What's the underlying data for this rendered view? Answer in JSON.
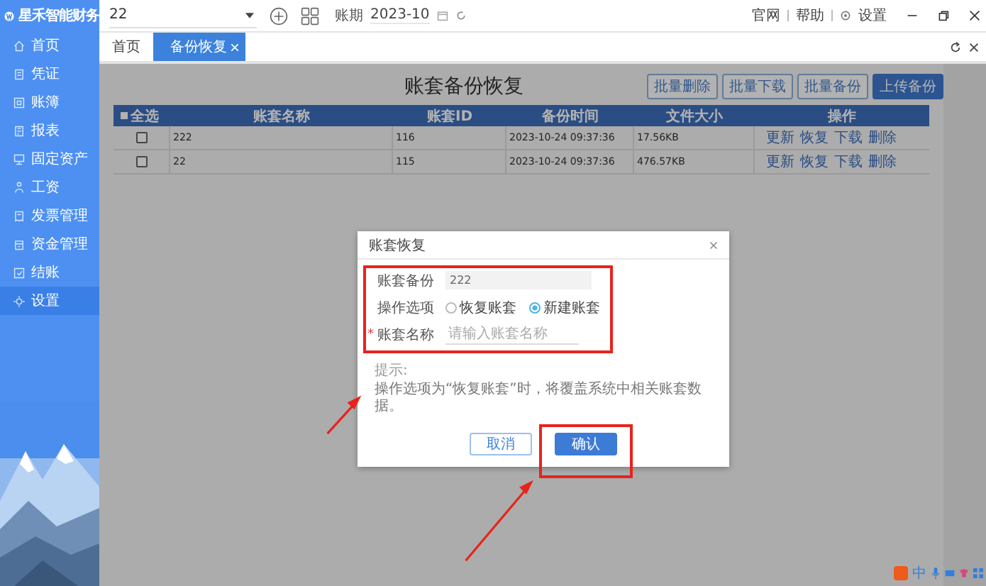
{
  "app": {
    "logo_text": "星禾智能财务",
    "account_select": "22",
    "period_label": "账期",
    "period_value": "2023-10",
    "top_links": [
      "官网",
      "帮助",
      "设置"
    ]
  },
  "sidebar": {
    "items": [
      {
        "label": "首页",
        "selected": false
      },
      {
        "label": "凭证",
        "selected": false
      },
      {
        "label": "账簿",
        "selected": false
      },
      {
        "label": "报表",
        "selected": false
      },
      {
        "label": "固定资产",
        "selected": false
      },
      {
        "label": "工资",
        "selected": false
      },
      {
        "label": "发票管理",
        "selected": false
      },
      {
        "label": "资金管理",
        "selected": false
      },
      {
        "label": "结账",
        "selected": false
      },
      {
        "label": "设置",
        "selected": true
      }
    ]
  },
  "tabs": [
    {
      "label": "首页",
      "selected": false,
      "closable": false
    },
    {
      "label": "备份恢复",
      "selected": true,
      "closable": true
    }
  ],
  "page": {
    "title": "账套备份恢复",
    "buttons": [
      {
        "label": "批量删除",
        "kind": "outline"
      },
      {
        "label": "批量下载",
        "kind": "outline"
      },
      {
        "label": "批量备份",
        "kind": "outline"
      },
      {
        "label": "上传备份",
        "kind": "primary"
      }
    ]
  },
  "table": {
    "select_all": "全选",
    "columns": [
      "账套名称",
      "账套ID",
      "备份时间",
      "文件大小",
      "操作"
    ],
    "rows": [
      {
        "checked": false,
        "cells": [
          "222",
          "116",
          "2023-10-24 09:37:36",
          "17.56KB"
        ],
        "actions": [
          "更新",
          "恢复",
          "下载",
          "删除"
        ]
      },
      {
        "checked": false,
        "cells": [
          "22",
          "115",
          "2023-10-24 09:37:36",
          "476.57KB"
        ],
        "actions": [
          "更新",
          "恢复",
          "下载",
          "删除"
        ]
      }
    ]
  },
  "dialog": {
    "title": "账套恢复",
    "backup": {
      "label": "账套备份",
      "value": "222"
    },
    "option": {
      "label": "操作选项",
      "options": [
        {
          "label": "恢复账套",
          "selected": false
        },
        {
          "label": "新建账套",
          "selected": true
        }
      ]
    },
    "name": {
      "label": "账套名称",
      "required": true,
      "required_mark": "*",
      "placeholder": "请输入账套名称"
    },
    "hint_title": "提示:",
    "hint_text": "操作选项为“恢复账套”时，将覆盖系统中相关账套数据。",
    "buttons": [
      {
        "label": "取消",
        "kind": "outline"
      },
      {
        "label": "确认",
        "kind": "primary"
      }
    ]
  },
  "tray": {
    "ime_label": "中"
  }
}
